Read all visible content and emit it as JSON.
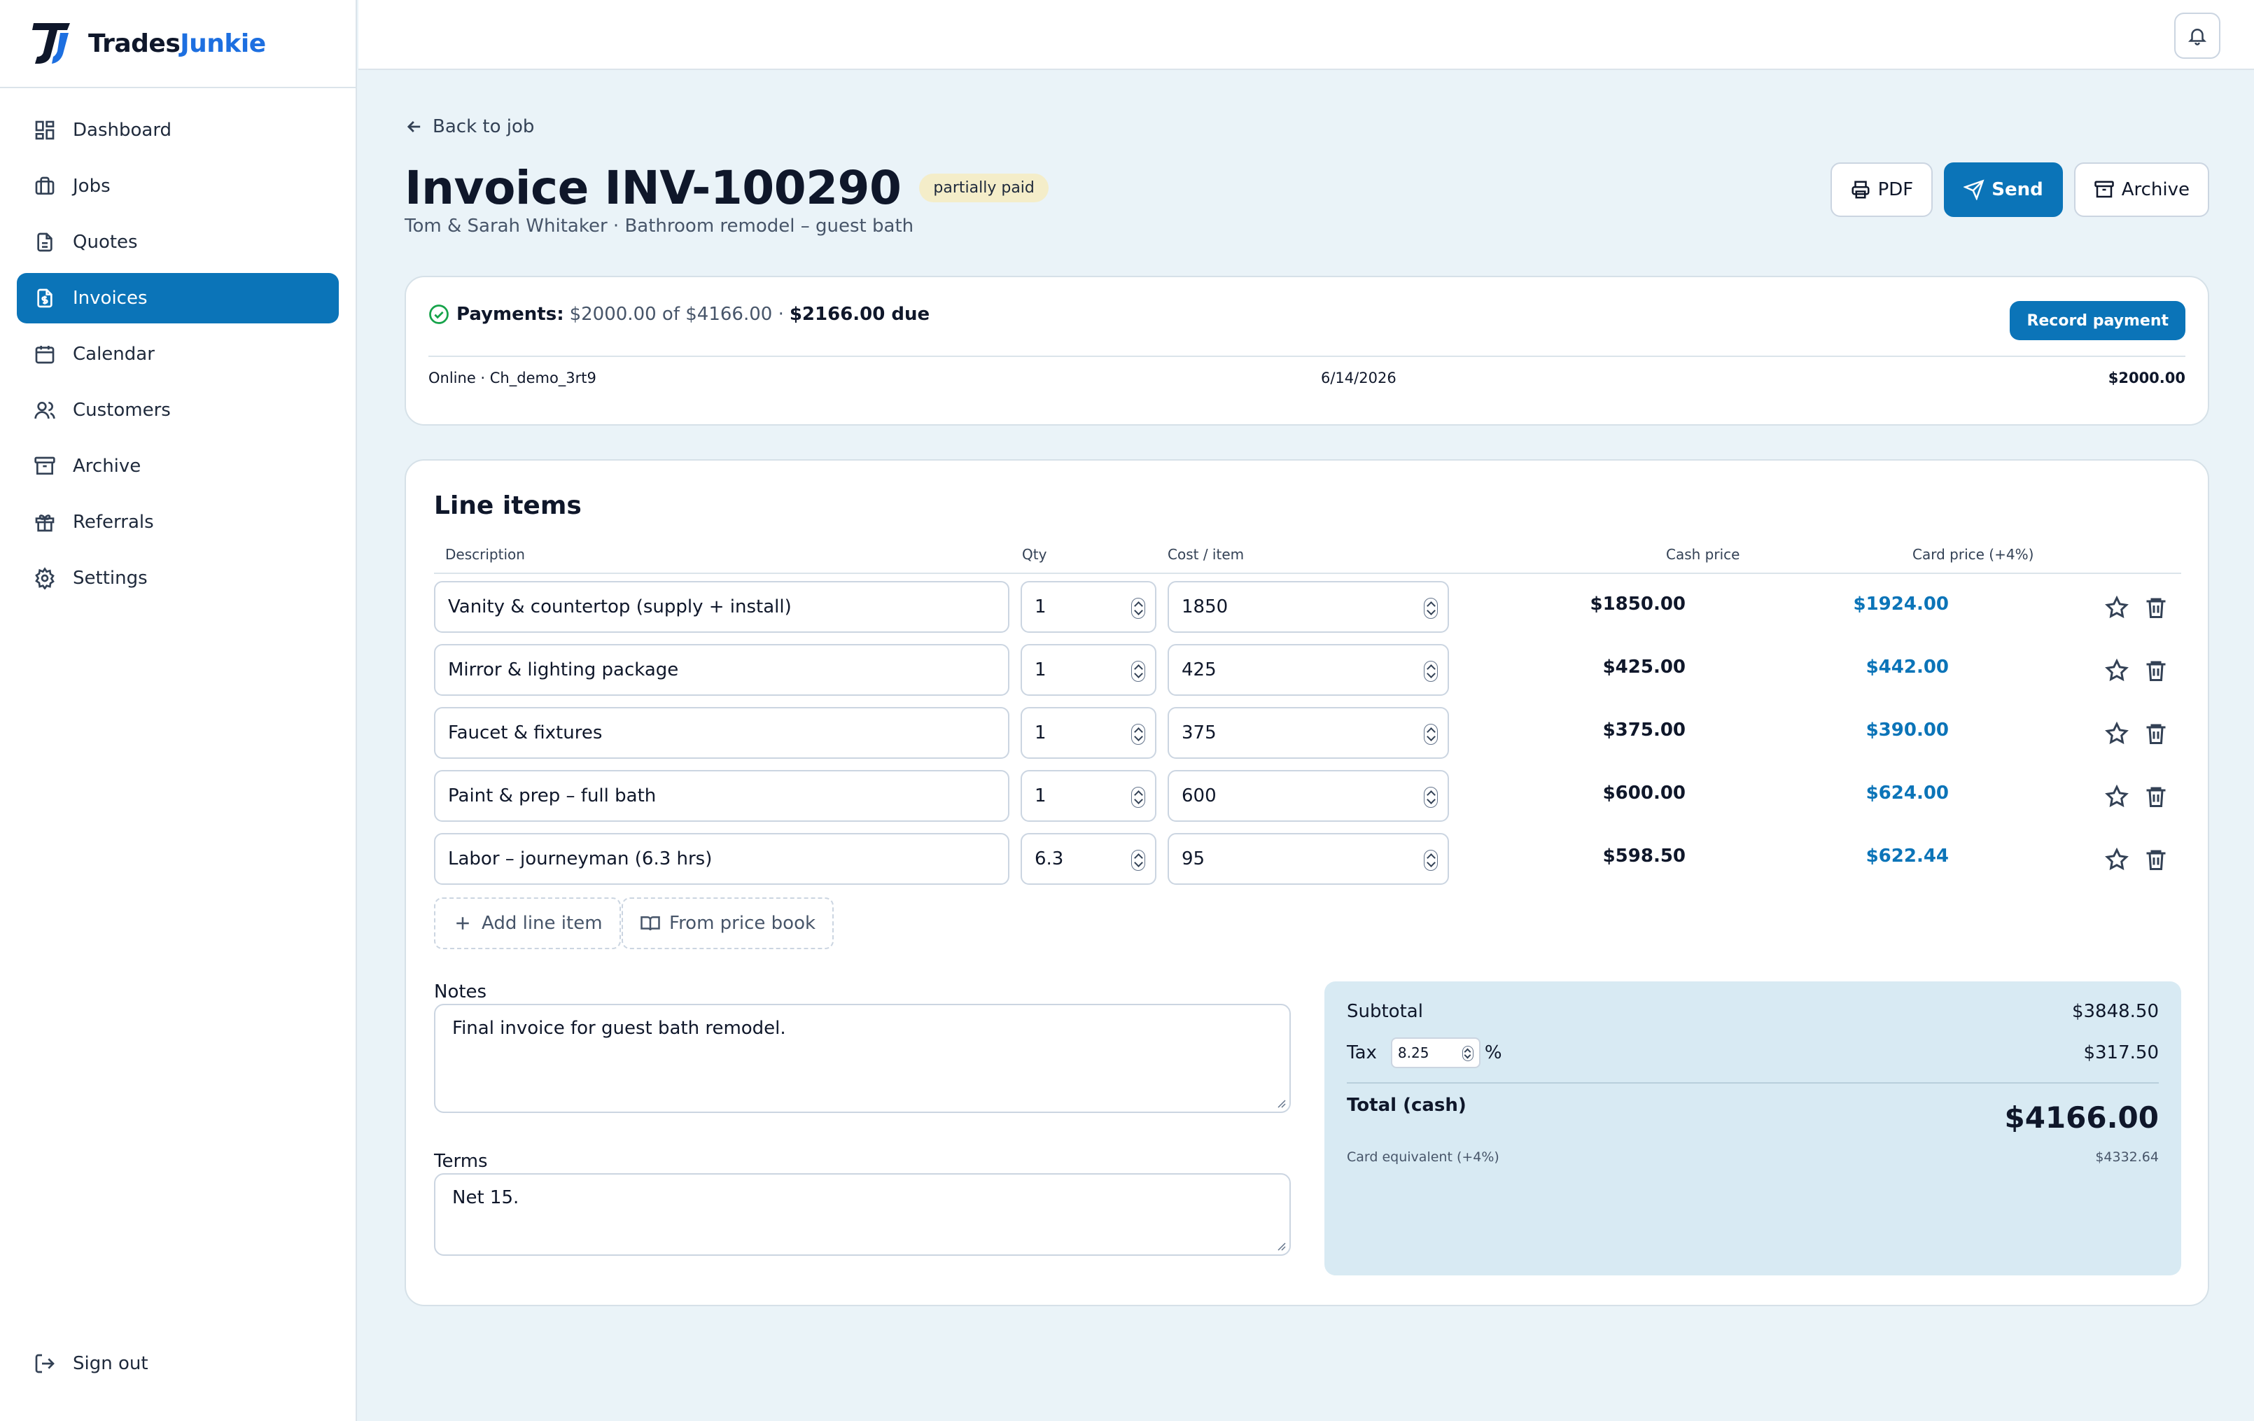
{
  "brand": {
    "part1": "Trades",
    "part2": "Junkie"
  },
  "nav": {
    "items": [
      {
        "label": "Dashboard"
      },
      {
        "label": "Jobs"
      },
      {
        "label": "Quotes"
      },
      {
        "label": "Invoices"
      },
      {
        "label": "Calendar"
      },
      {
        "label": "Customers"
      },
      {
        "label": "Archive"
      },
      {
        "label": "Referrals"
      },
      {
        "label": "Settings"
      }
    ],
    "active": "Invoices",
    "signout": "Sign out"
  },
  "page": {
    "back": "Back to job",
    "title": "Invoice INV-100290",
    "status": "partially paid",
    "subtitle": "Tom & Sarah Whitaker · Bathroom remodel – guest bath",
    "actions": {
      "pdf": "PDF",
      "send": "Send",
      "archive": "Archive"
    }
  },
  "payments": {
    "label": "Payments:",
    "paid_text": "$2000.00 of $4166.00 ·",
    "due_text": "$2166.00 due",
    "record_button": "Record payment",
    "rows": [
      {
        "method": "Online · Ch_demo_3rt9",
        "date": "6/14/2026",
        "amount": "$2000.00"
      }
    ]
  },
  "line_items": {
    "title": "Line items",
    "columns": {
      "description": "Description",
      "qty": "Qty",
      "cost": "Cost / item",
      "cash": "Cash price",
      "card": "Card price (+4%)"
    },
    "rows": [
      {
        "description": "Vanity & countertop (supply + install)",
        "qty": "1",
        "cost": "1850",
        "cash": "$1850.00",
        "card": "$1924.00"
      },
      {
        "description": "Mirror & lighting package",
        "qty": "1",
        "cost": "425",
        "cash": "$425.00",
        "card": "$442.00"
      },
      {
        "description": "Faucet & fixtures",
        "qty": "1",
        "cost": "375",
        "cash": "$375.00",
        "card": "$390.00"
      },
      {
        "description": "Paint & prep – full bath",
        "qty": "1",
        "cost": "600",
        "cash": "$600.00",
        "card": "$624.00"
      },
      {
        "description": "Labor – journeyman (6.3 hrs)",
        "qty": "6.3",
        "cost": "95",
        "cash": "$598.50",
        "card": "$622.44"
      }
    ],
    "add_button": "Add line item",
    "pricebook_button": "From price book"
  },
  "notes": {
    "label": "Notes",
    "value": "Final invoice for guest bath remodel."
  },
  "terms": {
    "label": "Terms",
    "value": "Net 15."
  },
  "totals": {
    "subtotal_label": "Subtotal",
    "subtotal": "$3848.50",
    "tax_label": "Tax",
    "tax_rate": "8.25",
    "tax_unit": "%",
    "tax": "$317.50",
    "total_label": "Total (cash)",
    "total": "$4166.00",
    "card_label": "Card equivalent (+4%)",
    "card_total": "$4332.64"
  },
  "colors": {
    "accent": "#0b74b8",
    "brand_blue": "#1d6fe0",
    "status_bg": "#f4edc9",
    "totals_bg": "#d8eaf3"
  }
}
